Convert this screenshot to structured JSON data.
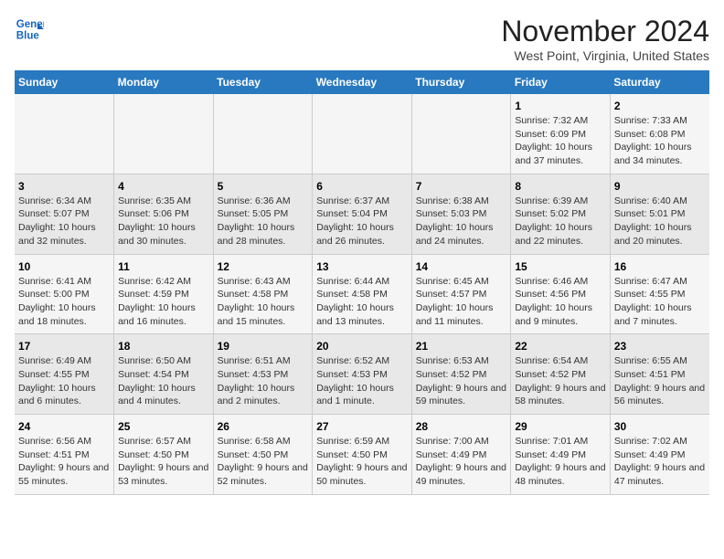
{
  "header": {
    "logo_line1": "General",
    "logo_line2": "Blue",
    "title": "November 2024",
    "subtitle": "West Point, Virginia, United States"
  },
  "days_of_week": [
    "Sunday",
    "Monday",
    "Tuesday",
    "Wednesday",
    "Thursday",
    "Friday",
    "Saturday"
  ],
  "weeks": [
    [
      {
        "day": "",
        "info": ""
      },
      {
        "day": "",
        "info": ""
      },
      {
        "day": "",
        "info": ""
      },
      {
        "day": "",
        "info": ""
      },
      {
        "day": "",
        "info": ""
      },
      {
        "day": "1",
        "info": "Sunrise: 7:32 AM\nSunset: 6:09 PM\nDaylight: 10 hours and 37 minutes."
      },
      {
        "day": "2",
        "info": "Sunrise: 7:33 AM\nSunset: 6:08 PM\nDaylight: 10 hours and 34 minutes."
      }
    ],
    [
      {
        "day": "3",
        "info": "Sunrise: 6:34 AM\nSunset: 5:07 PM\nDaylight: 10 hours and 32 minutes."
      },
      {
        "day": "4",
        "info": "Sunrise: 6:35 AM\nSunset: 5:06 PM\nDaylight: 10 hours and 30 minutes."
      },
      {
        "day": "5",
        "info": "Sunrise: 6:36 AM\nSunset: 5:05 PM\nDaylight: 10 hours and 28 minutes."
      },
      {
        "day": "6",
        "info": "Sunrise: 6:37 AM\nSunset: 5:04 PM\nDaylight: 10 hours and 26 minutes."
      },
      {
        "day": "7",
        "info": "Sunrise: 6:38 AM\nSunset: 5:03 PM\nDaylight: 10 hours and 24 minutes."
      },
      {
        "day": "8",
        "info": "Sunrise: 6:39 AM\nSunset: 5:02 PM\nDaylight: 10 hours and 22 minutes."
      },
      {
        "day": "9",
        "info": "Sunrise: 6:40 AM\nSunset: 5:01 PM\nDaylight: 10 hours and 20 minutes."
      }
    ],
    [
      {
        "day": "10",
        "info": "Sunrise: 6:41 AM\nSunset: 5:00 PM\nDaylight: 10 hours and 18 minutes."
      },
      {
        "day": "11",
        "info": "Sunrise: 6:42 AM\nSunset: 4:59 PM\nDaylight: 10 hours and 16 minutes."
      },
      {
        "day": "12",
        "info": "Sunrise: 6:43 AM\nSunset: 4:58 PM\nDaylight: 10 hours and 15 minutes."
      },
      {
        "day": "13",
        "info": "Sunrise: 6:44 AM\nSunset: 4:58 PM\nDaylight: 10 hours and 13 minutes."
      },
      {
        "day": "14",
        "info": "Sunrise: 6:45 AM\nSunset: 4:57 PM\nDaylight: 10 hours and 11 minutes."
      },
      {
        "day": "15",
        "info": "Sunrise: 6:46 AM\nSunset: 4:56 PM\nDaylight: 10 hours and 9 minutes."
      },
      {
        "day": "16",
        "info": "Sunrise: 6:47 AM\nSunset: 4:55 PM\nDaylight: 10 hours and 7 minutes."
      }
    ],
    [
      {
        "day": "17",
        "info": "Sunrise: 6:49 AM\nSunset: 4:55 PM\nDaylight: 10 hours and 6 minutes."
      },
      {
        "day": "18",
        "info": "Sunrise: 6:50 AM\nSunset: 4:54 PM\nDaylight: 10 hours and 4 minutes."
      },
      {
        "day": "19",
        "info": "Sunrise: 6:51 AM\nSunset: 4:53 PM\nDaylight: 10 hours and 2 minutes."
      },
      {
        "day": "20",
        "info": "Sunrise: 6:52 AM\nSunset: 4:53 PM\nDaylight: 10 hours and 1 minute."
      },
      {
        "day": "21",
        "info": "Sunrise: 6:53 AM\nSunset: 4:52 PM\nDaylight: 9 hours and 59 minutes."
      },
      {
        "day": "22",
        "info": "Sunrise: 6:54 AM\nSunset: 4:52 PM\nDaylight: 9 hours and 58 minutes."
      },
      {
        "day": "23",
        "info": "Sunrise: 6:55 AM\nSunset: 4:51 PM\nDaylight: 9 hours and 56 minutes."
      }
    ],
    [
      {
        "day": "24",
        "info": "Sunrise: 6:56 AM\nSunset: 4:51 PM\nDaylight: 9 hours and 55 minutes."
      },
      {
        "day": "25",
        "info": "Sunrise: 6:57 AM\nSunset: 4:50 PM\nDaylight: 9 hours and 53 minutes."
      },
      {
        "day": "26",
        "info": "Sunrise: 6:58 AM\nSunset: 4:50 PM\nDaylight: 9 hours and 52 minutes."
      },
      {
        "day": "27",
        "info": "Sunrise: 6:59 AM\nSunset: 4:50 PM\nDaylight: 9 hours and 50 minutes."
      },
      {
        "day": "28",
        "info": "Sunrise: 7:00 AM\nSunset: 4:49 PM\nDaylight: 9 hours and 49 minutes."
      },
      {
        "day": "29",
        "info": "Sunrise: 7:01 AM\nSunset: 4:49 PM\nDaylight: 9 hours and 48 minutes."
      },
      {
        "day": "30",
        "info": "Sunrise: 7:02 AM\nSunset: 4:49 PM\nDaylight: 9 hours and 47 minutes."
      }
    ]
  ]
}
